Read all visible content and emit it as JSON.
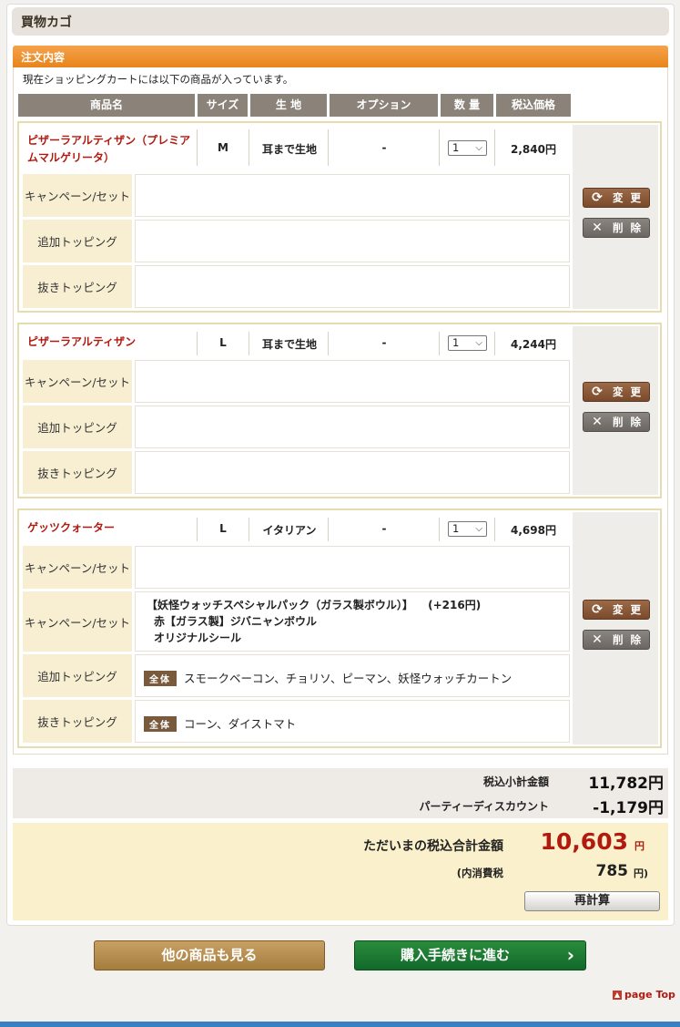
{
  "page": {
    "title": "買物カゴ"
  },
  "section": {
    "title": "注文内容",
    "intro": "現在ショッピングカートには以下の商品が入っています。"
  },
  "table_headers": [
    "商品名",
    "サイズ",
    "生 地",
    "オプション",
    "数 量",
    "税込価格"
  ],
  "row_labels": {
    "campaign": "キャンペーン/セット",
    "add_topping": "追加トッピング",
    "remove_topping": "抜きトッピング"
  },
  "buttons": {
    "change": "変 更",
    "delete": "削 除"
  },
  "items": [
    {
      "name": "ピザーラアルティザン（プレミアムマルゲリータ）",
      "size": "M",
      "dough": "耳まで生地",
      "option": "-",
      "qty": "1",
      "price": "2,840円"
    },
    {
      "name": "ピザーラアルティザン",
      "size": "L",
      "dough": "耳まで生地",
      "option": "-",
      "qty": "1",
      "price": "4,244円"
    },
    {
      "name": "ゲッツクォーター",
      "size": "L",
      "dough": "イタリアン",
      "option": "-",
      "qty": "1",
      "price": "4,698円",
      "campaign2": {
        "line1": "【妖怪ウォッチスペシャルパック（ガラス製ボウル）】",
        "line1_price": "(+216円)",
        "line2": "赤【ガラス製】ジバニャンボウル",
        "line3": "オリジナルシール"
      },
      "zentai_label": "全体",
      "add_toppings": "スモークベーコン、チョリソ、ピーマン、妖怪ウォッチカートン",
      "remove_toppings": "コーン、ダイストマト"
    }
  ],
  "summary": {
    "subtotal_label": "税込小計金額",
    "subtotal_value": "11,782円",
    "discount_label": "パーティーディスカウント",
    "discount_value": "-1,179円",
    "total_label": "ただいまの税込合計金額",
    "total_value": "10,603",
    "total_unit": "円",
    "tax_label": "(内消費税",
    "tax_value": "785",
    "tax_unit": "円)",
    "recalc_label": "再計算"
  },
  "footer": {
    "more_label": "他の商品も見る",
    "buy_label": "購入手続きに進む",
    "buy_arrow": "›",
    "pagetop_label": "page Top"
  },
  "colors": {
    "accent_orange": "#e8841c",
    "product_red": "#b21a0f",
    "buy_green": "#12692a"
  }
}
